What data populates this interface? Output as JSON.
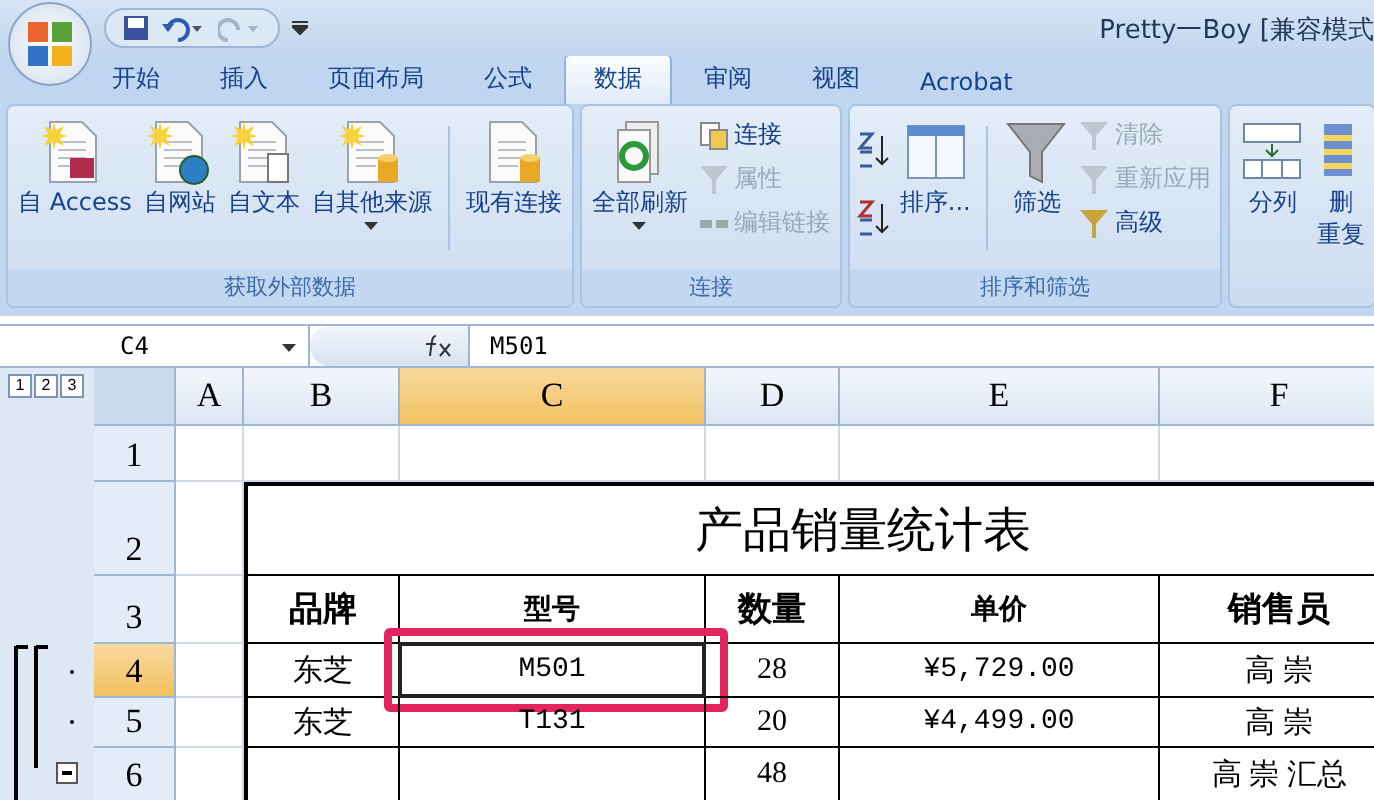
{
  "window": {
    "title": "Pretty一Boy  [兼容模式"
  },
  "tabs": [
    {
      "label": "开始",
      "selected": false
    },
    {
      "label": "插入",
      "selected": false
    },
    {
      "label": "页面布局",
      "selected": false
    },
    {
      "label": "公式",
      "selected": false
    },
    {
      "label": "数据",
      "selected": true
    },
    {
      "label": "审阅",
      "selected": false
    },
    {
      "label": "视图",
      "selected": false
    },
    {
      "label": "Acrobat",
      "selected": false
    }
  ],
  "ribbon": {
    "groups": [
      {
        "label": "获取外部数据",
        "items": [
          {
            "kind": "large",
            "label": "自 Access",
            "dropdown": false
          },
          {
            "kind": "large",
            "label": "自网站",
            "dropdown": false
          },
          {
            "kind": "large",
            "label": "自文本",
            "dropdown": false
          },
          {
            "kind": "large",
            "label": "自其他来源",
            "dropdown": true
          },
          {
            "kind": "separator"
          },
          {
            "kind": "large",
            "label": "现有连接",
            "dropdown": false
          }
        ]
      },
      {
        "label": "连接",
        "items": [
          {
            "kind": "large",
            "label": "全部刷新",
            "dropdown": true
          },
          {
            "kind": "stack",
            "entries": [
              {
                "label": "连接",
                "disabled": false
              },
              {
                "label": "属性",
                "disabled": true
              },
              {
                "label": "编辑链接",
                "disabled": true
              }
            ]
          }
        ]
      },
      {
        "label": "排序和筛选",
        "items": [
          {
            "kind": "sortpair"
          },
          {
            "kind": "large",
            "label": "排序...",
            "dropdown": false
          },
          {
            "kind": "separator"
          },
          {
            "kind": "large",
            "label": "筛选",
            "dropdown": false
          },
          {
            "kind": "stack",
            "entries": [
              {
                "label": "清除",
                "disabled": true
              },
              {
                "label": "重新应用",
                "disabled": true
              },
              {
                "label": "高级",
                "disabled": false
              }
            ]
          }
        ]
      },
      {
        "items": [
          {
            "kind": "large",
            "label": "分列",
            "dropdown": false
          },
          {
            "kind": "large",
            "label": "删",
            "label2": "重复",
            "dropdown": false
          }
        ]
      }
    ]
  },
  "formula_bar": {
    "name_box": "C4",
    "value": "M501"
  },
  "outline_levels": [
    "1",
    "2",
    "3"
  ],
  "columns": [
    {
      "label": "A",
      "selected": false
    },
    {
      "label": "B",
      "selected": false
    },
    {
      "label": "C",
      "selected": true
    },
    {
      "label": "D",
      "selected": false
    },
    {
      "label": "E",
      "selected": false
    },
    {
      "label": "F",
      "selected": false
    }
  ],
  "rows": [
    {
      "header": "1",
      "selected": false
    },
    {
      "header": "2",
      "selected": false,
      "title": "产品销量统计表"
    },
    {
      "header": "3",
      "selected": false,
      "kind": "heading",
      "cells": [
        "品牌",
        "型号",
        "数量",
        "单价",
        "销售员"
      ]
    },
    {
      "header": "4",
      "selected": true,
      "outline": {
        "kind": "start"
      },
      "cells": [
        "东芝",
        "M501",
        "28",
        "¥5,729.00",
        "高  崇"
      ]
    },
    {
      "header": "5",
      "selected": false,
      "outline": {
        "kind": "detail"
      },
      "cells": [
        "东芝",
        "T131",
        "20",
        "¥4,499.00",
        "高  崇"
      ]
    },
    {
      "header": "6",
      "selected": false,
      "outline": {
        "kind": "collapse"
      },
      "cells": [
        null,
        null,
        "48",
        null,
        "高  崇 汇总"
      ]
    }
  ],
  "highlight_frame": true
}
